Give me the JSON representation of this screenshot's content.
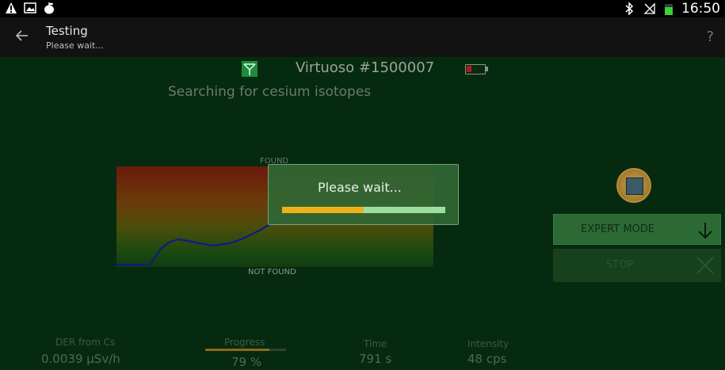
{
  "status_bar": {
    "time": "16:50",
    "icons_left": [
      "warning-icon",
      "picture-icon",
      "apple-icon"
    ],
    "icons_right": [
      "bluetooth-icon",
      "signal-off-icon",
      "battery-icon"
    ]
  },
  "action_bar": {
    "title": "Testing",
    "subtitle": "Please wait...",
    "help": "?"
  },
  "device": {
    "name": "Virtuoso #1500007",
    "status": "Searching for cesium isotopes"
  },
  "graph": {
    "found_label": "FOUND",
    "not_found_label": "NOT FOUND"
  },
  "buttons": {
    "expert_mode": "EXPERT MODE",
    "stop": "STOP"
  },
  "stats": {
    "der_label": "DER from Cs",
    "der_value": "0.0039 μSv/h",
    "progress_label": "Progress",
    "progress_value": "79 %",
    "progress_fraction": 0.79,
    "time_label": "Time",
    "time_value": "791 s",
    "intensity_label": "Intensity",
    "intensity_value": "48 cps"
  },
  "dialog": {
    "text": "Please wait...",
    "progress_fraction": 0.5
  },
  "colors": {
    "background": "#062a0f",
    "accent_green": "#2b6a34",
    "progress_orange": "#f0b01a",
    "battery_low": "#b11a1a"
  }
}
